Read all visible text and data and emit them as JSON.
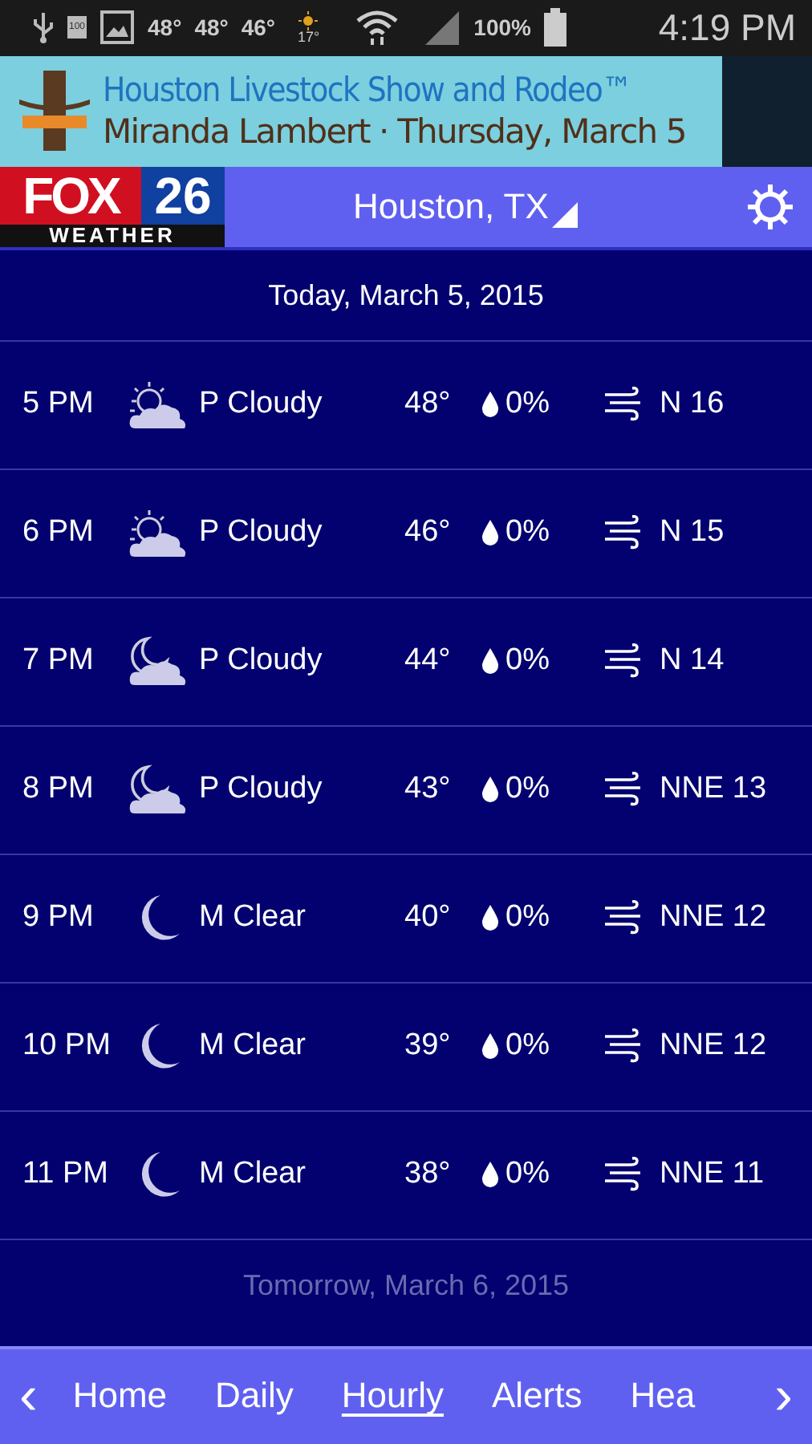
{
  "status_bar": {
    "battery_icon_text": "100",
    "temps": [
      "48°",
      "48°",
      "46°"
    ],
    "weather_temp": "17°",
    "battery": "100%",
    "time": "4:19 PM"
  },
  "ad": {
    "title": "Houston Livestock Show and Rodeo™",
    "subtitle": "Miranda Lambert · Thursday, March 5"
  },
  "header": {
    "logo_top": "FOX",
    "logo_number": "26",
    "logo_bottom": "WEATHER",
    "location": "Houston, TX"
  },
  "today": "Today, March 5, 2015",
  "rows": [
    {
      "time": "5 PM",
      "kind": "sun-cloud",
      "condition": "P Cloudy",
      "temp": "48°",
      "precip": "0%",
      "wind": "N 16"
    },
    {
      "time": "6 PM",
      "kind": "sun-cloud",
      "condition": "P Cloudy",
      "temp": "46°",
      "precip": "0%",
      "wind": "N 15"
    },
    {
      "time": "7 PM",
      "kind": "moon-cloud",
      "condition": "P Cloudy",
      "temp": "44°",
      "precip": "0%",
      "wind": "N 14"
    },
    {
      "time": "8 PM",
      "kind": "moon-cloud",
      "condition": "P Cloudy",
      "temp": "43°",
      "precip": "0%",
      "wind": "NNE 13"
    },
    {
      "time": "9 PM",
      "kind": "moon",
      "condition": "M Clear",
      "temp": "40°",
      "precip": "0%",
      "wind": "NNE 12"
    },
    {
      "time": "10 PM",
      "kind": "moon",
      "condition": "M Clear",
      "temp": "39°",
      "precip": "0%",
      "wind": "NNE 12"
    },
    {
      "time": "11 PM",
      "kind": "moon",
      "condition": "M Clear",
      "temp": "38°",
      "precip": "0%",
      "wind": "NNE 11"
    }
  ],
  "tomorrow": "Tomorrow, March 6, 2015",
  "nav": {
    "prev": "‹",
    "next": "›",
    "tabs": [
      {
        "label": "Home",
        "selected": false
      },
      {
        "label": "Daily",
        "selected": false
      },
      {
        "label": "Hourly",
        "selected": true
      },
      {
        "label": "Alerts",
        "selected": false
      },
      {
        "label": "Hea",
        "selected": false
      }
    ]
  }
}
